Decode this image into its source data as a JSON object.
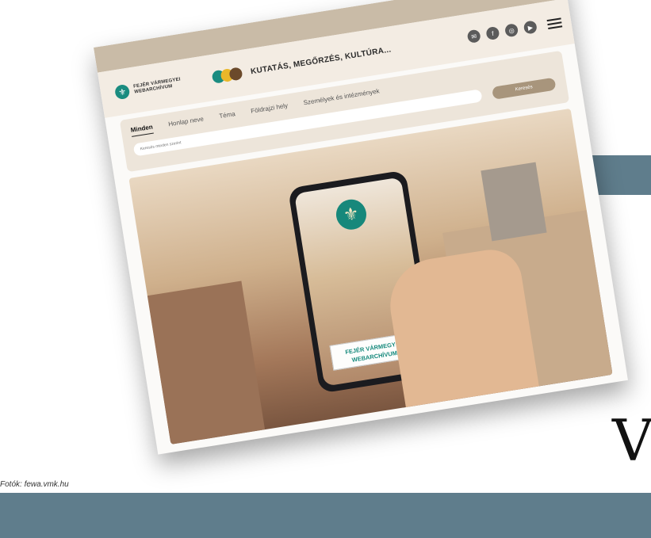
{
  "article": {
    "photo_credit": "Fotók: fewa.vmk.hu",
    "side_letter": "V"
  },
  "site": {
    "logo_text_line1": "FEJÉR VÁRMEGYEI",
    "logo_text_line2": "WEBARCHÍVUM",
    "tagline": "KUTATÁS, MEGŐRZÉS, KULTÚRA...",
    "social_icons": [
      "mail-icon",
      "facebook-icon",
      "instagram-icon",
      "youtube-icon"
    ],
    "menu_icon": "hamburger-menu-icon",
    "brand_colors": {
      "teal": "#1a8c80",
      "gold": "#e9b72a",
      "brown": "#6b4a2b",
      "beige": "#c9bba7"
    }
  },
  "search": {
    "tabs": [
      "Minden",
      "Honlap neve",
      "Téma",
      "Földrajzi hely",
      "Személyek és intézmények"
    ],
    "active_tab": "Minden",
    "placeholder": "Keresés minden szerint",
    "button_label": "Keresés"
  },
  "hero": {
    "phone_label_line1": "FEJÉR VÁRMEGYEI",
    "phone_label_line2": "WEBARCHÍVUM"
  }
}
